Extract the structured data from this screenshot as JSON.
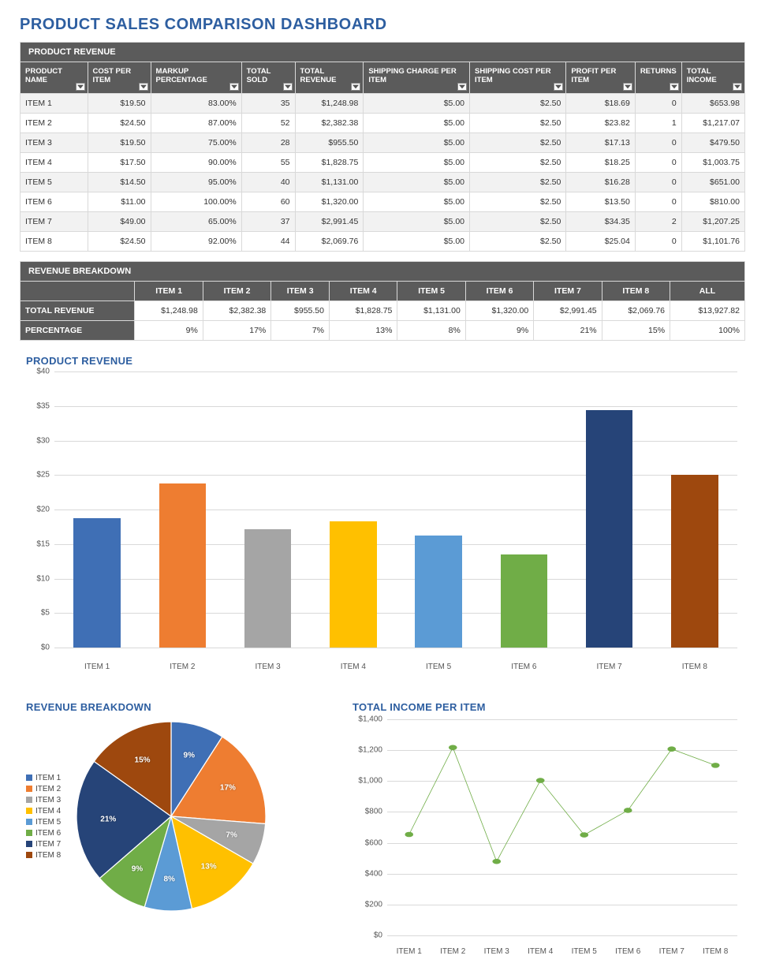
{
  "page_title": "PRODUCT SALES COMPARISON DASHBOARD",
  "revenue_table": {
    "panel_title": "PRODUCT REVENUE",
    "columns": [
      "PRODUCT NAME",
      "COST PER ITEM",
      "MARKUP PERCENTAGE",
      "TOTAL SOLD",
      "TOTAL REVENUE",
      "SHIPPING CHARGE PER ITEM",
      "SHIPPING COST PER ITEM",
      "PROFIT PER ITEM",
      "RETURNS",
      "TOTAL INCOME"
    ],
    "rows": [
      {
        "name": "ITEM 1",
        "cost": "$19.50",
        "markup": "83.00%",
        "sold": "35",
        "rev": "$1,248.98",
        "ship_chg": "$5.00",
        "ship_cost": "$2.50",
        "profit": "$18.69",
        "returns": "0",
        "income": "$653.98"
      },
      {
        "name": "ITEM 2",
        "cost": "$24.50",
        "markup": "87.00%",
        "sold": "52",
        "rev": "$2,382.38",
        "ship_chg": "$5.00",
        "ship_cost": "$2.50",
        "profit": "$23.82",
        "returns": "1",
        "income": "$1,217.07"
      },
      {
        "name": "ITEM 3",
        "cost": "$19.50",
        "markup": "75.00%",
        "sold": "28",
        "rev": "$955.50",
        "ship_chg": "$5.00",
        "ship_cost": "$2.50",
        "profit": "$17.13",
        "returns": "0",
        "income": "$479.50"
      },
      {
        "name": "ITEM 4",
        "cost": "$17.50",
        "markup": "90.00%",
        "sold": "55",
        "rev": "$1,828.75",
        "ship_chg": "$5.00",
        "ship_cost": "$2.50",
        "profit": "$18.25",
        "returns": "0",
        "income": "$1,003.75"
      },
      {
        "name": "ITEM 5",
        "cost": "$14.50",
        "markup": "95.00%",
        "sold": "40",
        "rev": "$1,131.00",
        "ship_chg": "$5.00",
        "ship_cost": "$2.50",
        "profit": "$16.28",
        "returns": "0",
        "income": "$651.00"
      },
      {
        "name": "ITEM 6",
        "cost": "$11.00",
        "markup": "100.00%",
        "sold": "60",
        "rev": "$1,320.00",
        "ship_chg": "$5.00",
        "ship_cost": "$2.50",
        "profit": "$13.50",
        "returns": "0",
        "income": "$810.00"
      },
      {
        "name": "ITEM 7",
        "cost": "$49.00",
        "markup": "65.00%",
        "sold": "37",
        "rev": "$2,991.45",
        "ship_chg": "$5.00",
        "ship_cost": "$2.50",
        "profit": "$34.35",
        "returns": "2",
        "income": "$1,207.25"
      },
      {
        "name": "ITEM 8",
        "cost": "$24.50",
        "markup": "92.00%",
        "sold": "44",
        "rev": "$2,069.76",
        "ship_chg": "$5.00",
        "ship_cost": "$2.50",
        "profit": "$25.04",
        "returns": "0",
        "income": "$1,101.76"
      }
    ]
  },
  "breakdown_table": {
    "panel_title": "REVENUE BREAKDOWN",
    "cols": [
      "ITEM 1",
      "ITEM 2",
      "ITEM 3",
      "ITEM 4",
      "ITEM 5",
      "ITEM 6",
      "ITEM 7",
      "ITEM 8",
      "ALL"
    ],
    "row1_label": "TOTAL REVENUE",
    "row1": [
      "$1,248.98",
      "$2,382.38",
      "$955.50",
      "$1,828.75",
      "$1,131.00",
      "$1,320.00",
      "$2,991.45",
      "$2,069.76",
      "$13,927.82"
    ],
    "row2_label": "PERCENTAGE",
    "row2": [
      "9%",
      "17%",
      "7%",
      "13%",
      "8%",
      "9%",
      "21%",
      "15%",
      "100%"
    ]
  },
  "colors": [
    "#3f6fb5",
    "#ee7d31",
    "#a5a5a5",
    "#ffc000",
    "#5b9bd5",
    "#70ad47",
    "#264478",
    "#9e480e"
  ],
  "chart_data": [
    {
      "type": "bar",
      "title": "PRODUCT REVENUE",
      "categories": [
        "ITEM 1",
        "ITEM 2",
        "ITEM 3",
        "ITEM 4",
        "ITEM 5",
        "ITEM 6",
        "ITEM 7",
        "ITEM 8"
      ],
      "values": [
        18.69,
        23.82,
        17.13,
        18.25,
        16.28,
        13.5,
        34.35,
        25.04
      ],
      "ylabel": "",
      "ylim": [
        0,
        40
      ],
      "ytick_labels": [
        "$0",
        "$5",
        "$10",
        "$15",
        "$20",
        "$25",
        "$30",
        "$35",
        "$40"
      ]
    },
    {
      "type": "pie",
      "title": "REVENUE BREAKDOWN",
      "categories": [
        "ITEM 1",
        "ITEM 2",
        "ITEM 3",
        "ITEM 4",
        "ITEM 5",
        "ITEM 6",
        "ITEM 7",
        "ITEM 8"
      ],
      "values": [
        9,
        17,
        7,
        13,
        8,
        9,
        21,
        15
      ],
      "data_labels": [
        "9%",
        "17%",
        "7%",
        "13%",
        "8%",
        "9%",
        "21%",
        "15%"
      ]
    },
    {
      "type": "line",
      "title": "TOTAL INCOME PER ITEM",
      "categories": [
        "ITEM 1",
        "ITEM 2",
        "ITEM 3",
        "ITEM 4",
        "ITEM 5",
        "ITEM 6",
        "ITEM 7",
        "ITEM 8"
      ],
      "values": [
        653.98,
        1217.07,
        479.5,
        1003.75,
        651.0,
        810.0,
        1207.25,
        1101.76
      ],
      "ylim": [
        0,
        1400
      ],
      "ytick_labels": [
        "$0",
        "$200",
        "$400",
        "$600",
        "$800",
        "$1,000",
        "$1,200",
        "$1,400"
      ]
    }
  ]
}
